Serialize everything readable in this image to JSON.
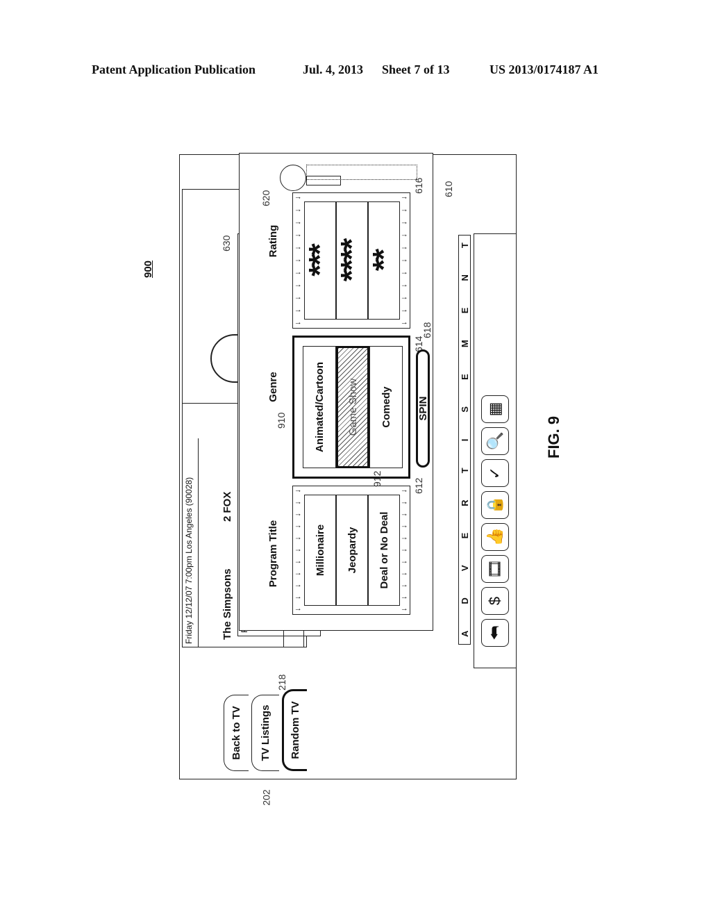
{
  "header": {
    "publication": "Patent Application Publication",
    "date": "Jul. 4, 2013",
    "sheet": "Sheet 7 of 13",
    "number": "US 2013/0174187 A1"
  },
  "figure": {
    "label": "FIG. 9",
    "number": "900"
  },
  "refs": {
    "r202": "202",
    "r218": "218",
    "r610": "610",
    "r612": "612",
    "r614": "614",
    "r616": "616",
    "r618": "618",
    "r620": "620",
    "r630": "630",
    "r910": "910",
    "r912": "912"
  },
  "tabs": [
    {
      "label": "Back to TV",
      "active": false
    },
    {
      "label": "TV Listings",
      "active": false
    },
    {
      "label": "Random TV",
      "active": true
    }
  ],
  "background_panel": {
    "info_line": "Friday  12/12/07  7:00pm  Los Angeles (90028)",
    "show_title": "The Simpsons",
    "channel": "2 FOX"
  },
  "listing_panel": {
    "info_line": "Friday  12/12/07  7:00pm  Los Angeles (90028)"
  },
  "random_tv": {
    "columns": [
      {
        "title": "Program Title",
        "items": [
          "Millionaire",
          "Jeopardy",
          "Deal or No Deal"
        ],
        "selected_index": null
      },
      {
        "title": "Genre",
        "items": [
          "Animated/Cartoon",
          "Game Show",
          "Comedy"
        ],
        "selected_index": 1
      },
      {
        "title": "Rating",
        "items": [
          "***",
          "****",
          "**"
        ],
        "selected_index": null
      }
    ],
    "spin_label": "SPIN",
    "lever_icon": "slot-lever-icon"
  },
  "advertisement": {
    "letters": [
      "A",
      "D",
      "V",
      "E",
      "R",
      "T",
      "I",
      "S",
      "E",
      "M",
      "E",
      "N",
      "T"
    ]
  },
  "toolbar": {
    "icons": [
      {
        "name": "back-arrow-icon",
        "glyph": "⮪"
      },
      {
        "name": "dollar-icon",
        "glyph": "$"
      },
      {
        "name": "film-strip-icon",
        "glyph": "🎞"
      },
      {
        "name": "thumbs-up-down-icon",
        "glyph": "👍"
      },
      {
        "name": "lock-icon",
        "glyph": "🔒"
      },
      {
        "name": "checkmark-icon",
        "glyph": "✓"
      },
      {
        "name": "search-icon",
        "glyph": "🔍"
      },
      {
        "name": "keypad-icon",
        "glyph": "▦"
      }
    ]
  }
}
